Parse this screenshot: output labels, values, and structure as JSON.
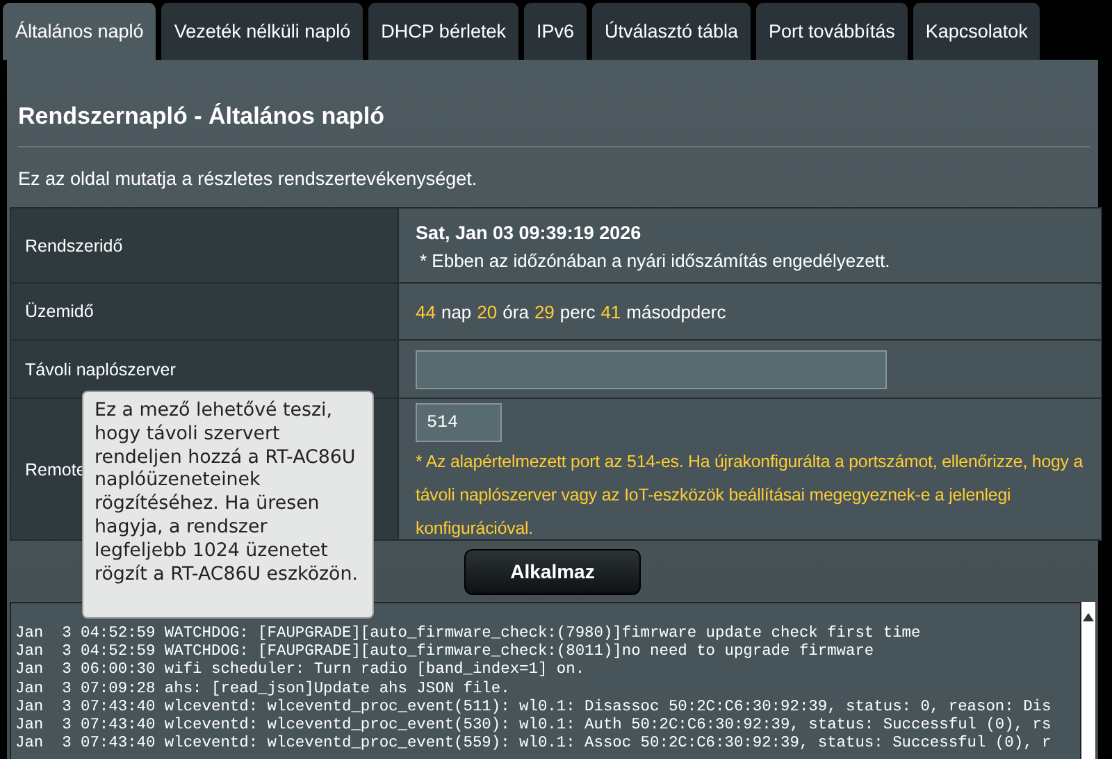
{
  "tabs": [
    {
      "label": "Általános napló",
      "selected": true
    },
    {
      "label": "Vezeték nélküli napló",
      "selected": false
    },
    {
      "label": "DHCP bérletek",
      "selected": false
    },
    {
      "label": "IPv6",
      "selected": false
    },
    {
      "label": "Útválasztó tábla",
      "selected": false
    },
    {
      "label": "Port továbbítás",
      "selected": false
    },
    {
      "label": "Kapcsolatok",
      "selected": false
    }
  ],
  "title": "Rendszernapló - Általános napló",
  "description": "Ez az oldal mutatja a részletes rendszertevékenységet.",
  "system_time": {
    "label": "Rendszeridő",
    "value": "Sat, Jan 03 09:39:19 2026",
    "note": "* Ebben az időzónában a nyári időszámítás engedélyezett."
  },
  "uptime": {
    "label": "Üzemidő",
    "parts": [
      {
        "value": "44",
        "unit": "nap"
      },
      {
        "value": "20",
        "unit": "óra"
      },
      {
        "value": "29",
        "unit": "perc"
      },
      {
        "value": "41",
        "unit": "másodpderc"
      }
    ]
  },
  "remote_server": {
    "label": "Távoli naplószerver"
  },
  "remote_port": {
    "label": "Remote",
    "value": "514",
    "note": "* Az alapértelmezett port az 514-es. Ha újrakonfigurálta a portszámot, ellenőrizze, hogy a távoli naplószerver vagy az IoT-eszközök beállításai megegyeznek-e a jelenlegi konfigurációval."
  },
  "tooltip": "Ez a mező lehetővé teszi, hogy távoli szervert rendeljen hozzá a RT-AC86U naplóüzeneteinek rögzítéséhez. Ha üresen hagyja, a rendszer legfeljebb 1024 üzenetet rögzít a RT-AC86U eszközön.",
  "apply_button": "Alkalmaz",
  "log_lines": [
    "Jan  3 04:52:59 WATCHDOG: [FAUPGRADE][auto_firmware_check:(7980)]fimrware update check first time",
    "Jan  3 04:52:59 WATCHDOG: [FAUPGRADE][auto_firmware_check:(8011)]no need to upgrade firmware",
    "Jan  3 06:00:30 wifi scheduler: Turn radio [band_index=1] on.",
    "Jan  3 07:09:28 ahs: [read_json]Update ahs JSON file.",
    "Jan  3 07:43:40 wlceventd: wlceventd_proc_event(511): wl0.1: Disassoc 50:2C:C6:30:92:39, status: 0, reason: Dis",
    "Jan  3 07:43:40 wlceventd: wlceventd_proc_event(530): wl0.1: Auth 50:2C:C6:30:92:39, status: Successful (0), rs",
    "Jan  3 07:43:40 wlceventd: wlceventd_proc_event(559): wl0.1: Assoc 50:2C:C6:30:92:39, status: Successful (0), r"
  ]
}
